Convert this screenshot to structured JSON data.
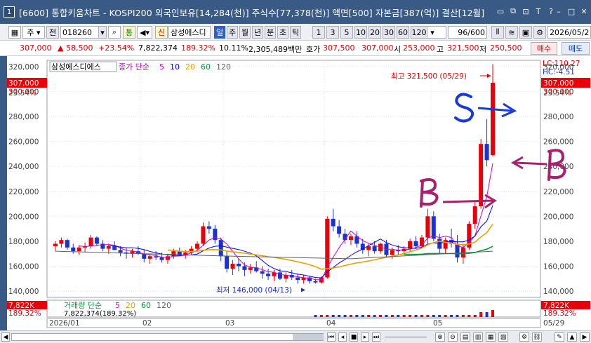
{
  "window": {
    "number": "1",
    "title": "[6600] 통합키움차트 - KOSPI200 외국인보유[14,284(천)] 주식수[77,378(천)] 액면[500] 자본금[387(억)] 결산[12월]"
  },
  "toolbar": {
    "market": "주",
    "prev": "전",
    "code": "018260",
    "stock_name": "삼성에스디",
    "tag_tong": "통",
    "tag_sin": "신",
    "periods": [
      "일",
      "주",
      "월",
      "년",
      "분",
      "초",
      "틱"
    ],
    "active_period": "일",
    "intervals": [
      "1",
      "3",
      "5",
      "10",
      "20",
      "30",
      "60",
      "120"
    ],
    "count": "96",
    "total": "/600",
    "date": "2026/05/2"
  },
  "quote": {
    "price": "307,000",
    "change": "▲ 58,500",
    "change_pct": "+23.54%",
    "volume": "7,822,374",
    "vol_ratio": "189.32%",
    "turnover": "10.11%",
    "amount": "2,305,489백만",
    "hoga_label": "호가",
    "ask": "307,500",
    "bid": "307,000",
    "open_label": "시",
    "open": "253,000",
    "high_label": "고",
    "high": "321,500",
    "low_label": "저",
    "low": "250,500",
    "buy": "매수",
    "sell": "매도"
  },
  "chart_data": {
    "type": "candlestick",
    "stock_label": "삼성에스디에스",
    "legend": {
      "price": "종가",
      "ma_type": "단순",
      "periods": [
        "5",
        "10",
        "20",
        "60",
        "120"
      ],
      "colors": [
        "#cc00cc",
        "#0000ff",
        "#e8a000",
        "#009933",
        "#606060"
      ]
    },
    "y_ticks": [
      "320,000",
      "300,000",
      "280,000",
      "260,000",
      "240,000",
      "220,000",
      "200,000",
      "180,000",
      "160,000",
      "140,000"
    ],
    "ylim": [
      135000,
      325000
    ],
    "x_labels": [
      "2026/01",
      "02",
      "03",
      "04",
      "05",
      "05/29"
    ],
    "current_price_tag": "307,000",
    "current_pct_tag": "23.54%",
    "high_annotation": "최고 321,500 (05/29)",
    "low_annotation": "최저 146,000 (04/13)",
    "lc_label": "LC:110.27",
    "hc_label": "HC:-4.51",
    "candles": [
      [
        176,
        180,
        172,
        178
      ],
      [
        178,
        183,
        175,
        181
      ],
      [
        181,
        182,
        173,
        175
      ],
      [
        175,
        178,
        170,
        172
      ],
      [
        172,
        177,
        169,
        175
      ],
      [
        175,
        179,
        171,
        176
      ],
      [
        176,
        185,
        174,
        183
      ],
      [
        183,
        184,
        176,
        178
      ],
      [
        178,
        181,
        172,
        174
      ],
      [
        174,
        178,
        170,
        176
      ],
      [
        176,
        180,
        173,
        173
      ],
      [
        173,
        176,
        168,
        171
      ],
      [
        171,
        175,
        166,
        170
      ],
      [
        170,
        174,
        167,
        172
      ],
      [
        172,
        176,
        169,
        170
      ],
      [
        170,
        173,
        163,
        166
      ],
      [
        166,
        169,
        162,
        168
      ],
      [
        168,
        172,
        165,
        167
      ],
      [
        167,
        171,
        163,
        165
      ],
      [
        165,
        170,
        162,
        168
      ],
      [
        168,
        174,
        166,
        172
      ],
      [
        172,
        175,
        168,
        169
      ],
      [
        169,
        173,
        166,
        171
      ],
      [
        171,
        176,
        169,
        174
      ],
      [
        174,
        180,
        172,
        178
      ],
      [
        178,
        195,
        176,
        192
      ],
      [
        192,
        196,
        186,
        190
      ],
      [
        190,
        193,
        178,
        181
      ],
      [
        181,
        183,
        164,
        168
      ],
      [
        168,
        172,
        155,
        158
      ],
      [
        158,
        165,
        153,
        162
      ],
      [
        162,
        166,
        156,
        160
      ],
      [
        160,
        163,
        152,
        157
      ],
      [
        157,
        162,
        154,
        159
      ],
      [
        159,
        164,
        155,
        156
      ],
      [
        156,
        160,
        150,
        154
      ],
      [
        154,
        158,
        149,
        152
      ],
      [
        152,
        157,
        148,
        155
      ],
      [
        155,
        158,
        149,
        150
      ],
      [
        150,
        155,
        147,
        153
      ],
      [
        153,
        157,
        149,
        151
      ],
      [
        151,
        154,
        146,
        149
      ],
      [
        149,
        153,
        146,
        151
      ],
      [
        151,
        152,
        146,
        148
      ],
      [
        148,
        150,
        146,
        147
      ],
      [
        147,
        152,
        146,
        151
      ],
      [
        151,
        200,
        150,
        198
      ],
      [
        198,
        206,
        188,
        192
      ],
      [
        192,
        197,
        183,
        186
      ],
      [
        186,
        190,
        178,
        181
      ],
      [
        181,
        186,
        177,
        184
      ],
      [
        184,
        188,
        175,
        178
      ],
      [
        178,
        182,
        170,
        173
      ],
      [
        173,
        178,
        168,
        176
      ],
      [
        176,
        180,
        170,
        172
      ],
      [
        172,
        179,
        170,
        178
      ],
      [
        178,
        181,
        167,
        169
      ],
      [
        169,
        175,
        166,
        173
      ],
      [
        173,
        177,
        169,
        172
      ],
      [
        172,
        176,
        169,
        174
      ],
      [
        174,
        182,
        172,
        180
      ],
      [
        180,
        184,
        174,
        176
      ],
      [
        176,
        185,
        174,
        183
      ],
      [
        183,
        206,
        178,
        200
      ],
      [
        200,
        204,
        180,
        182
      ],
      [
        182,
        186,
        170,
        174
      ],
      [
        174,
        183,
        170,
        181
      ],
      [
        181,
        190,
        175,
        178
      ],
      [
        178,
        185,
        163,
        167
      ],
      [
        167,
        178,
        162,
        175
      ],
      [
        175,
        196,
        173,
        194
      ],
      [
        194,
        212,
        190,
        208
      ],
      [
        208,
        262,
        206,
        258
      ],
      [
        258,
        278,
        240,
        245
      ],
      [
        249,
        322,
        248,
        307
      ]
    ],
    "volume_tag": "7,822K",
    "volume_pct_tag": "189.32%",
    "volume_legend": {
      "label": "거래량",
      "ma_type": "단순",
      "periods": [
        "5",
        "20",
        "60",
        "120"
      ]
    },
    "volume_value": "7,822,374(189.32%)"
  },
  "annotations": {
    "sell_mark": "S",
    "buy_mark_1": "B",
    "buy_mark_2": "B"
  }
}
